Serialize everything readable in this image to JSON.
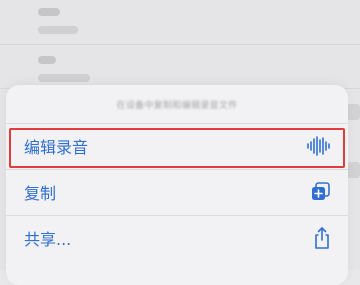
{
  "sheet": {
    "title": "在设备中复制和编辑录音文件",
    "actions": [
      {
        "label": "编辑录音",
        "icon": "waveform-icon"
      },
      {
        "label": "复制",
        "icon": "duplicate-icon"
      },
      {
        "label": "共享...",
        "icon": "share-icon"
      }
    ]
  },
  "colors": {
    "accent": "#2f6fd2",
    "highlight": "#e23b3b"
  }
}
